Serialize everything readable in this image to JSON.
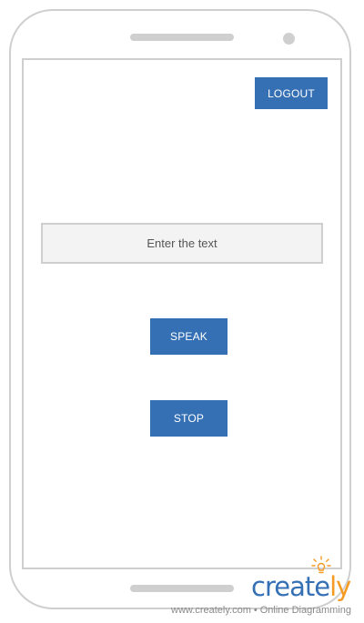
{
  "header": {
    "logout_label": "LOGOUT"
  },
  "main": {
    "text_input": {
      "placeholder": "Enter the text",
      "value": ""
    },
    "speak_label": "SPEAK",
    "stop_label": "STOP"
  },
  "watermark": {
    "logo_text_main": "create",
    "logo_text_tail": "ly",
    "site": "www.creately.com",
    "separator": "•",
    "tagline": "Online Diagramming",
    "icon": "lightbulb-icon"
  },
  "colors": {
    "button": "#3570b5",
    "button_text": "#ffffff",
    "input_bg": "#f3f3f3",
    "frame": "#cfcfcf",
    "logo_blue": "#3570b5",
    "logo_orange": "#f59a22"
  }
}
